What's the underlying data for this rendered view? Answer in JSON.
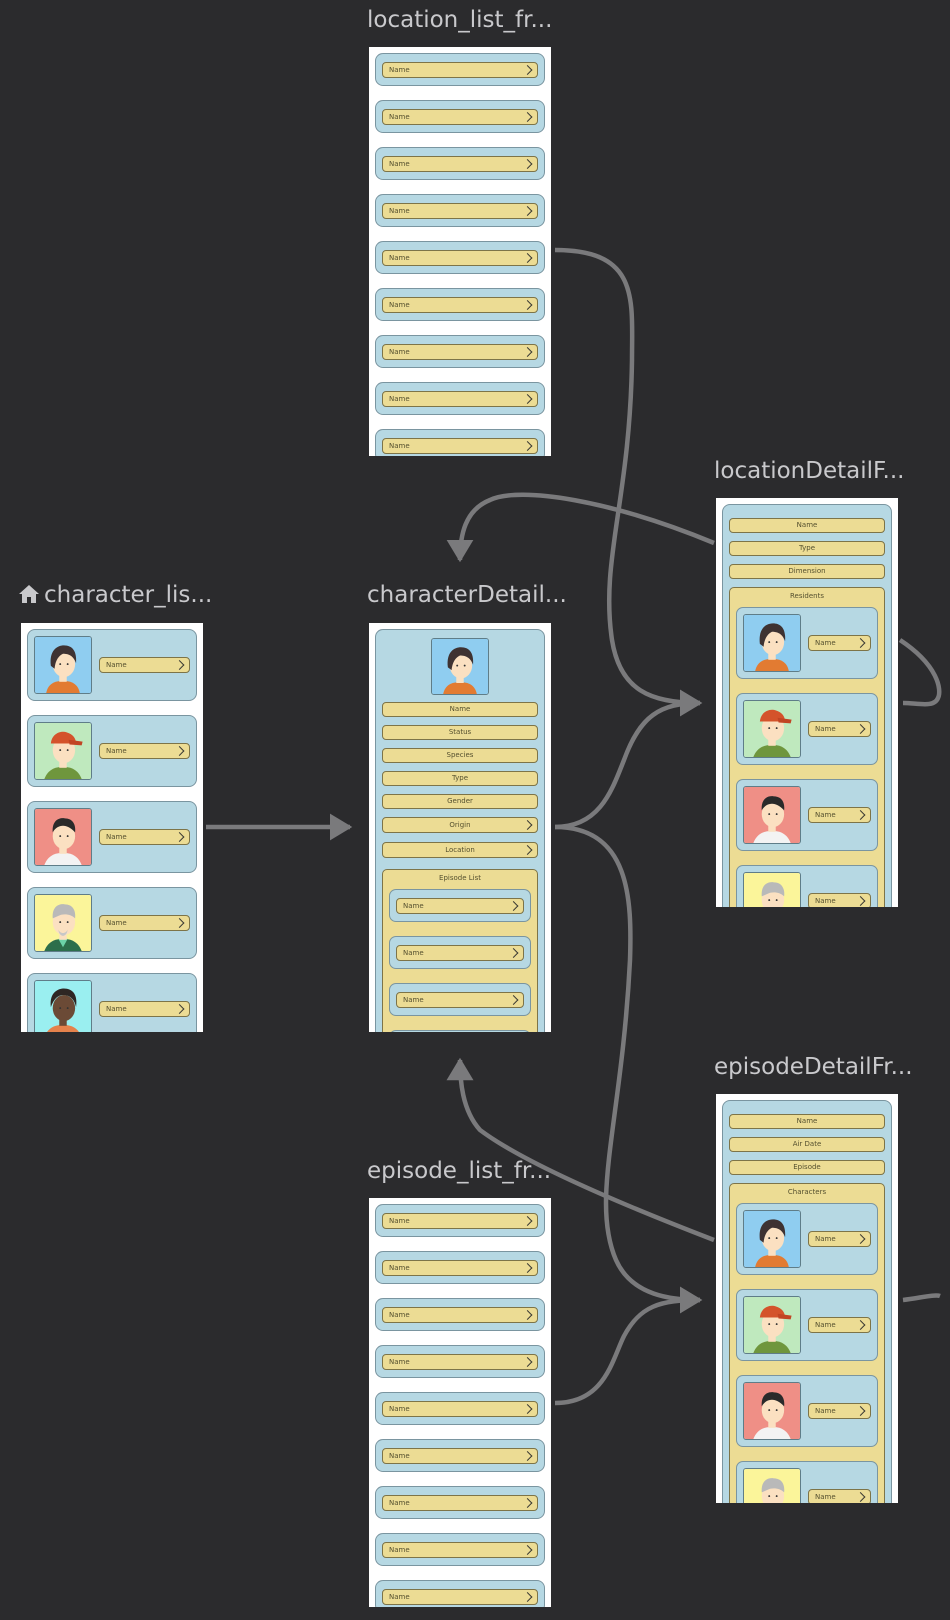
{
  "destinations": {
    "location_list": {
      "title": "location_list_fr...",
      "item_label": "Name",
      "items": 9
    },
    "location_detail": {
      "title": "locationDetailF...",
      "fields": [
        "Name",
        "Type",
        "Dimension"
      ],
      "section": "Residents",
      "item_label": "Name"
    },
    "character_list": {
      "title": "character_lis...",
      "item_label": "Name",
      "is_start": true
    },
    "character_detail": {
      "title": "characterDetail...",
      "fields": [
        "Name",
        "Status",
        "Species",
        "Type",
        "Gender"
      ],
      "nav_fields": [
        "Origin",
        "Location"
      ],
      "section": "Episode List",
      "item_label": "Name"
    },
    "episode_list": {
      "title": "episode_list_fr...",
      "item_label": "Name",
      "items": 9
    },
    "episode_detail": {
      "title": "episodeDetailFr...",
      "fields": [
        "Name",
        "Air Date",
        "Episode"
      ],
      "section": "Characters",
      "item_label": "Name"
    }
  },
  "avatars": [
    {
      "name": "avatar-girl-icon",
      "bg": "#8fcdf0"
    },
    {
      "name": "avatar-cap-boy-icon",
      "bg": "#bfe9be"
    },
    {
      "name": "avatar-boy-icon",
      "bg": "#ef8f86"
    },
    {
      "name": "avatar-old-man-icon",
      "bg": "#fbf59a"
    },
    {
      "name": "avatar-dark-boy-icon",
      "bg": "#9aeff0"
    }
  ],
  "colors": {
    "canvas": "#2b2b2d",
    "card": "#b6d8e3",
    "field": "#ecdc94",
    "arrow": "#7a7a7c",
    "title": "#c9c9cc"
  }
}
